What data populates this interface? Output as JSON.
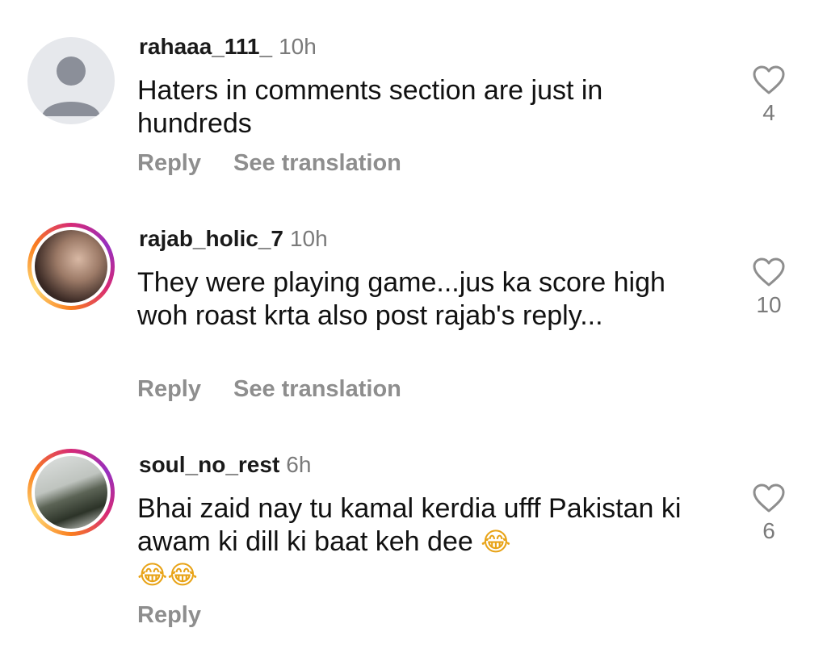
{
  "comments": [
    {
      "username": "rahaaa_111_",
      "time": "10h",
      "text": "Haters in comments section are just in hundreds",
      "reply_label": "Reply",
      "translate_label": "See translation",
      "likes": "4"
    },
    {
      "username": "rajab_holic_7",
      "time": "10h",
      "text": "They were playing game...jus ka score high woh roast krta also post rajab's reply...",
      "reply_label": "Reply",
      "translate_label": "See translation",
      "likes": "10"
    },
    {
      "username": "soul_no_rest",
      "time": "6h",
      "text": "Bhai zaid nay tu kamal kerdia ufff Pakistan ki awam ki dill ki baat keh dee",
      "emoji": "😂",
      "emoji_row": "😂😂",
      "reply_label": "Reply",
      "likes": "6"
    }
  ],
  "icons": {
    "heart": "heart-outline-icon",
    "default_avatar": "user-silhouette-icon"
  }
}
